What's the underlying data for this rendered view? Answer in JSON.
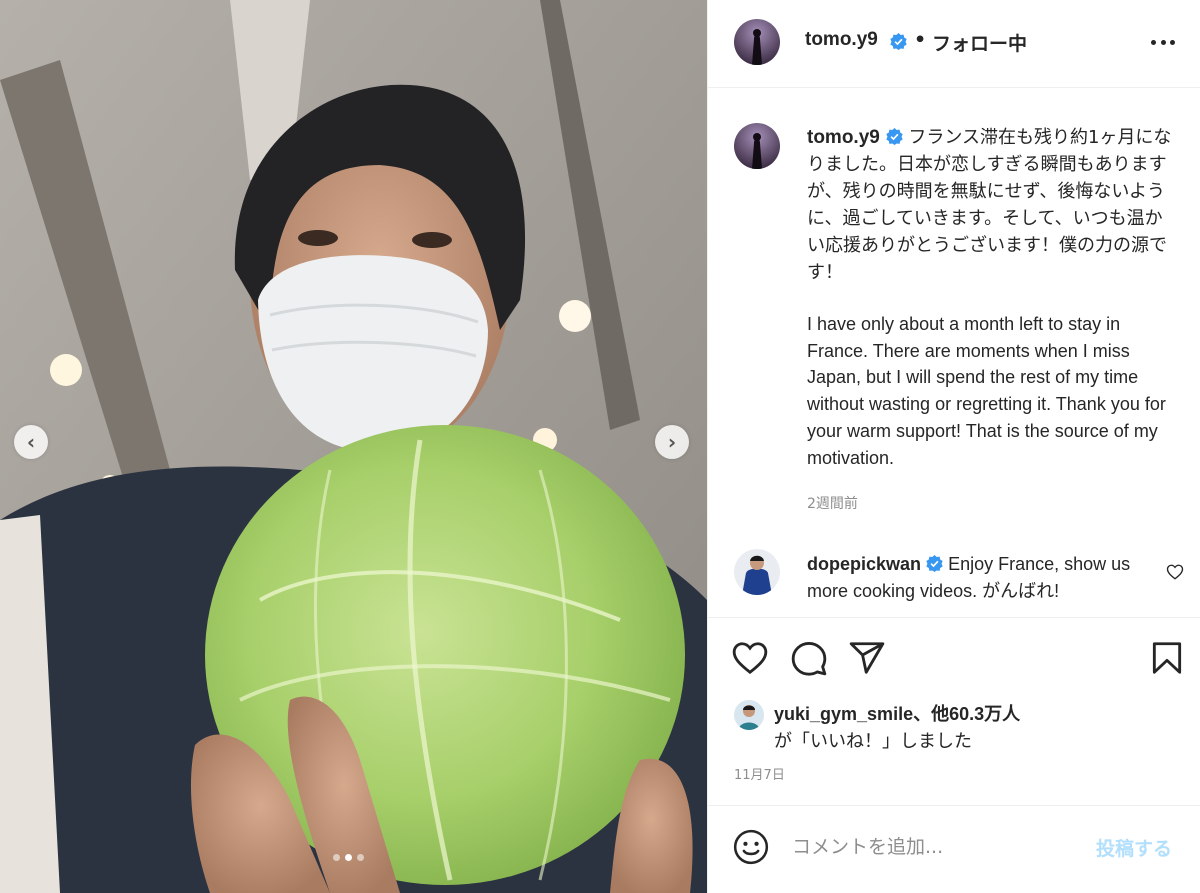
{
  "post": {
    "username": "tomo.y9",
    "follow_separator": "•",
    "follow_status": "フォロー中",
    "more_icon": "more-horizontal-icon",
    "caption_ja": "フランス滞在も残り約1ヶ月になりました。日本が恋しすぎる瞬間もありますが、残りの時間を無駄にせず、後悔ないように、過ごしていきます。そして、いつも温かい応援ありがとうございます！僕の力の源です！",
    "caption_en": "I have only about a month left to stay in France. There are moments when I miss Japan, but I will spend the rest of my time without wasting or regretting it. Thank you for your warm support! That is the source of my motivation.",
    "caption_time": "2週間前",
    "date": "11月7日"
  },
  "comment": {
    "username": "dopepickwan",
    "text": "Enjoy France, show us more cooking videos. がんばれ!"
  },
  "likes": {
    "first_user": "yuki_gym_smile",
    "others": "、他60.3万人",
    "suffix": "が「いいね！」しました"
  },
  "comment_box": {
    "placeholder": "コメントを追加...",
    "post_label": "投稿する"
  },
  "carousel": {
    "prev_glyph": "‹",
    "next_glyph": "›",
    "current_index": 2,
    "total": 3
  },
  "colors": {
    "verified": "#3897f0",
    "post_button_disabled": "#b2dffc",
    "secondary_text": "#8e8e8e"
  }
}
